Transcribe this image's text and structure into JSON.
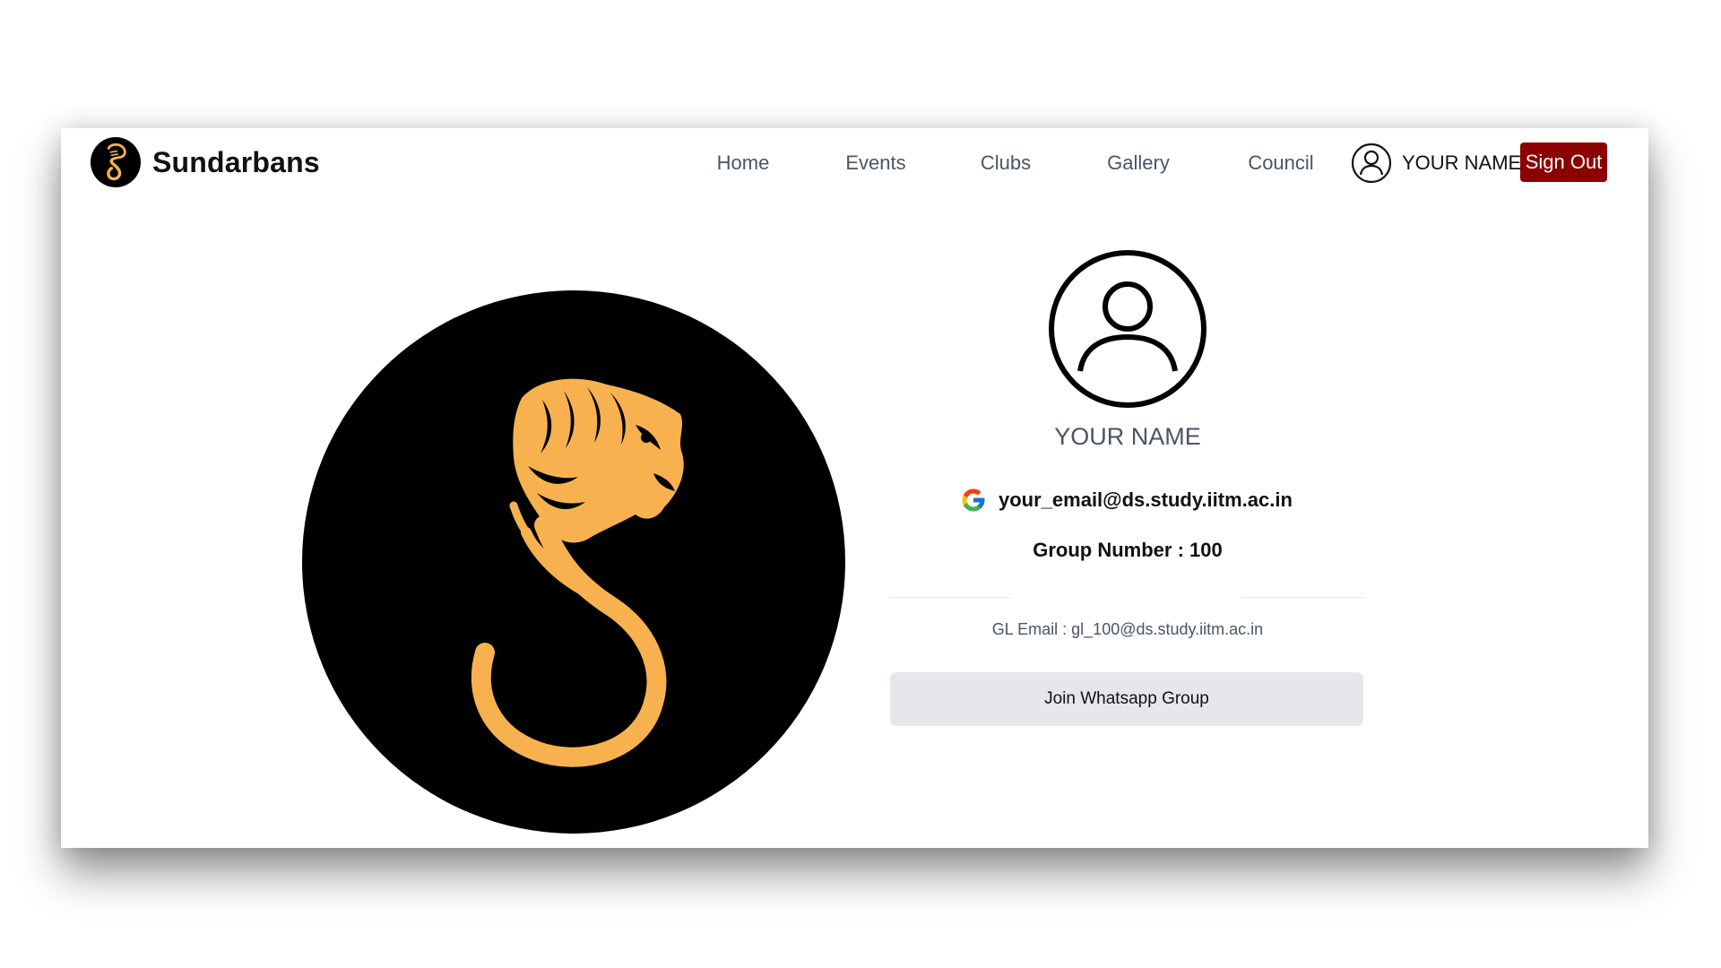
{
  "brand": {
    "name": "Sundarbans",
    "logo_icon": "sundarbans-tiger-logo",
    "logo_background": "#000000",
    "logo_color": "#f7b24f"
  },
  "nav": {
    "links": [
      {
        "label": "Home"
      },
      {
        "label": "Events"
      },
      {
        "label": "Clubs"
      },
      {
        "label": "Gallery"
      },
      {
        "label": "Council"
      }
    ],
    "user_icon": "user-circle-icon",
    "user_name": "YOUR NAME",
    "signout_label": "Sign Out",
    "signout_color": "#8b0000"
  },
  "profile": {
    "avatar_icon": "user-circle-icon",
    "name": "YOUR NAME",
    "email_icon": "google-icon",
    "email": "your_email@ds.study.iitm.ac.in",
    "group_label": "Group Number : ",
    "group_number": "100",
    "gl_email_label": "GL Email : ",
    "gl_email": "gl_100@ds.study.iitm.ac.in",
    "whatsapp_button": "Join Whatsapp Group"
  }
}
